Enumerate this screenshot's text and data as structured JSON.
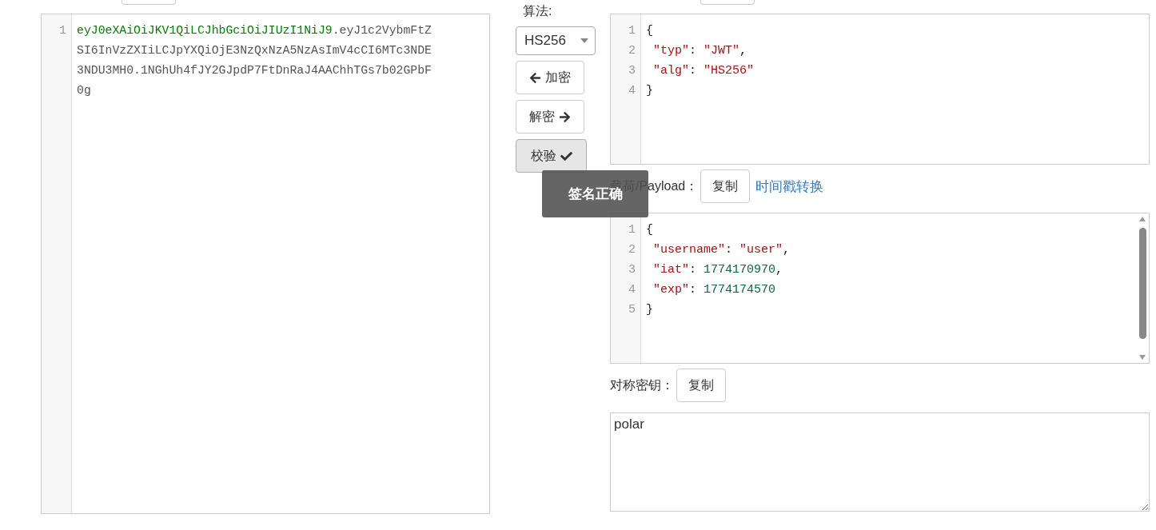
{
  "token_editor": {
    "line_number": "1",
    "parts": [
      {
        "text": "eyJ0eXAiOiJKV1QiLCJhbGciOiJIUzI1NiJ9",
        "kind": "header"
      },
      {
        "text": ".eyJ1c2VybmFtZSI6InVzZXIiLCJpYXQiOjE3NzQxNzA5NzAsImV4cCI6MTc3NDE3NDU3MH0.1NGhUh4fJY2GJpdP7FtDnRaJ4AAChhTGs7b02GPbF0g",
        "kind": "rest"
      }
    ]
  },
  "controls": {
    "algorithm_label": "算法:",
    "algorithm": "HS256",
    "buttons": [
      {
        "label": "加密",
        "kind": "encrypt",
        "pressed": false
      },
      {
        "label": "解密",
        "kind": "decrypt",
        "pressed": false
      },
      {
        "label": "校验",
        "kind": "verify",
        "pressed": true
      }
    ]
  },
  "toast": "签名正确",
  "header_editor": {
    "lines": [
      {
        "number": "1",
        "tokens": [
          {
            "text": "{",
            "kind": "punct"
          }
        ]
      },
      {
        "number": "2",
        "tokens": [
          {
            "text": " \"typ\"",
            "kind": "string"
          },
          {
            "text": ": ",
            "kind": "punct"
          },
          {
            "text": "\"JWT\"",
            "kind": "string"
          },
          {
            "text": ",",
            "kind": "punct"
          }
        ]
      },
      {
        "number": "3",
        "tokens": [
          {
            "text": " \"alg\"",
            "kind": "string"
          },
          {
            "text": ": ",
            "kind": "punct"
          },
          {
            "text": "\"HS256\"",
            "kind": "string"
          }
        ]
      },
      {
        "number": "4",
        "tokens": [
          {
            "text": "}",
            "kind": "punct"
          }
        ]
      }
    ]
  },
  "payload": {
    "label": "载荷/Payload：",
    "copy_button": "复制",
    "link": "时间戳转换"
  },
  "payload_editor": {
    "lines": [
      {
        "number": "1",
        "tokens": [
          {
            "text": "{",
            "kind": "punct"
          }
        ]
      },
      {
        "number": "2",
        "tokens": [
          {
            "text": " \"username\"",
            "kind": "string"
          },
          {
            "text": ": ",
            "kind": "punct"
          },
          {
            "text": "\"user\"",
            "kind": "string"
          },
          {
            "text": ",",
            "kind": "punct"
          }
        ]
      },
      {
        "number": "3",
        "tokens": [
          {
            "text": " \"iat\"",
            "kind": "string"
          },
          {
            "text": ": ",
            "kind": "punct"
          },
          {
            "text": "1774170970",
            "kind": "number"
          },
          {
            "text": ",",
            "kind": "punct"
          }
        ]
      },
      {
        "number": "4",
        "tokens": [
          {
            "text": " \"exp\"",
            "kind": "string"
          },
          {
            "text": ": ",
            "kind": "punct"
          },
          {
            "text": "1774174570",
            "kind": "number"
          }
        ]
      },
      {
        "number": "5",
        "tokens": [
          {
            "text": "}",
            "kind": "punct"
          }
        ]
      }
    ]
  },
  "secret": {
    "label": "对称密钥：",
    "copy_button": "复制",
    "value": "polar"
  }
}
